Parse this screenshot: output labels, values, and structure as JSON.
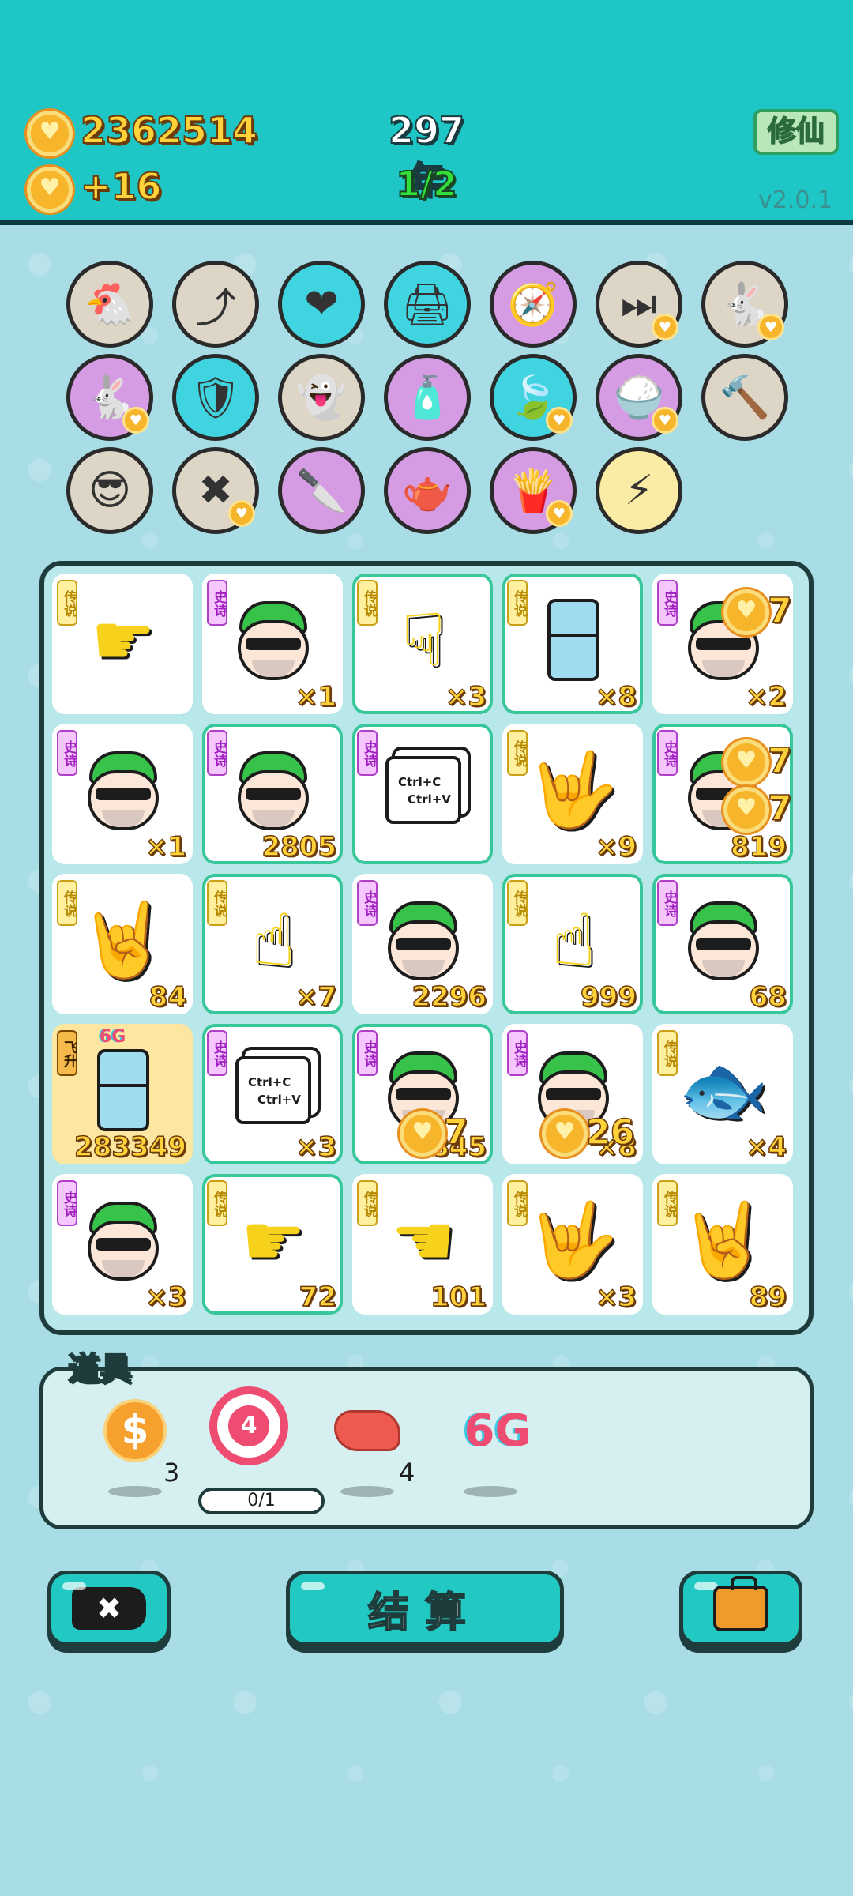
{
  "header": {
    "coins": "2362514",
    "income": "+16",
    "year": "297年",
    "round": "1/2",
    "cultivate_button": "修仙",
    "version": "v2.0.1"
  },
  "relics": [
    {
      "name": "hen-egg",
      "glyph": "🐔",
      "color": "beige"
    },
    {
      "name": "upgrade-arrow",
      "glyph": "⤴",
      "color": "beige"
    },
    {
      "name": "heart-bowl",
      "glyph": "❤",
      "color": "cyan"
    },
    {
      "name": "printer-warning",
      "glyph": "🖨",
      "color": "cyan"
    },
    {
      "name": "compass",
      "glyph": "🧭",
      "color": "purple"
    },
    {
      "name": "skip-tag",
      "glyph": "⏭",
      "color": "beige",
      "badge": true
    },
    {
      "name": "rabbit-white",
      "glyph": "🐇",
      "color": "beige",
      "badge": true
    },
    {
      "name": "rabbit-pink",
      "glyph": "🐇",
      "color": "purple",
      "badge": true
    },
    {
      "name": "shield-wrench",
      "glyph": "🛡",
      "color": "cyan"
    },
    {
      "name": "ghost",
      "glyph": "👻",
      "color": "beige"
    },
    {
      "name": "spray-bottle",
      "glyph": "🧴",
      "color": "purple"
    },
    {
      "name": "leaf",
      "glyph": "🍃",
      "color": "cyan",
      "badge": true
    },
    {
      "name": "rice-bowl",
      "glyph": "🍚",
      "color": "purple",
      "badge": true
    },
    {
      "name": "hammer",
      "glyph": "🔨",
      "color": "beige"
    },
    {
      "name": "sunglasses-cat",
      "glyph": "😎",
      "color": "beige"
    },
    {
      "name": "delete-tag",
      "glyph": "✖",
      "color": "beige",
      "badge": true
    },
    {
      "name": "cleaver",
      "glyph": "🔪",
      "color": "purple"
    },
    {
      "name": "gravy-boat",
      "glyph": "🫖",
      "color": "purple"
    },
    {
      "name": "fries",
      "glyph": "🍟",
      "color": "purple",
      "badge": true
    },
    {
      "name": "lightning",
      "glyph": "⚡",
      "color": "yellow"
    }
  ],
  "board": [
    {
      "tag": "传说",
      "tier": "legend",
      "kind": "pointer",
      "glyph": "☛",
      "count": "",
      "glow": false
    },
    {
      "tag": "史诗",
      "tier": "epic",
      "kind": "face",
      "count": "×1",
      "glow": false
    },
    {
      "tag": "传说",
      "tier": "legend",
      "kind": "pointer",
      "glyph": "☟",
      "count": "×3",
      "glow": true
    },
    {
      "tag": "传说",
      "tier": "legend",
      "kind": "fridge",
      "count": "×8",
      "glow": true
    },
    {
      "tag": "史诗",
      "tier": "epic",
      "kind": "face",
      "count": "×2",
      "glow": false
    },
    {
      "tag": "史诗",
      "tier": "epic",
      "kind": "face",
      "count": "×1",
      "glow": false
    },
    {
      "tag": "史诗",
      "tier": "epic",
      "kind": "face",
      "count": "2805",
      "glow": true
    },
    {
      "tag": "史诗",
      "tier": "epic",
      "kind": "copy",
      "count": "",
      "glow": true
    },
    {
      "tag": "传说",
      "tier": "legend",
      "kind": "pointer",
      "glyph": "🤟",
      "count": "×9",
      "glow": false
    },
    {
      "tag": "史诗",
      "tier": "epic",
      "kind": "face",
      "count": "819",
      "glow": true
    },
    {
      "tag": "传说",
      "tier": "legend",
      "kind": "pointer",
      "glyph": "🤘",
      "count": "84",
      "glow": false
    },
    {
      "tag": "传说",
      "tier": "legend",
      "kind": "pointer",
      "glyph": "☝",
      "count": "×7",
      "glow": true
    },
    {
      "tag": "史诗",
      "tier": "epic",
      "kind": "face",
      "count": "2296",
      "glow": false
    },
    {
      "tag": "传说",
      "tier": "legend",
      "kind": "pointer",
      "glyph": "☝",
      "count": "999",
      "glow": true
    },
    {
      "tag": "史诗",
      "tier": "epic",
      "kind": "face",
      "count": "68",
      "glow": true
    },
    {
      "tag": "飞升",
      "tier": "ascend",
      "kind": "fridge",
      "count": "283349",
      "glow": false,
      "gold": true,
      "label": "6G"
    },
    {
      "tag": "史诗",
      "tier": "epic",
      "kind": "copy",
      "count": "×3",
      "glow": true
    },
    {
      "tag": "史诗",
      "tier": "epic",
      "kind": "face",
      "count": "845",
      "glow": true
    },
    {
      "tag": "史诗",
      "tier": "epic",
      "kind": "face",
      "count": "×8",
      "glow": false
    },
    {
      "tag": "传说",
      "tier": "legend",
      "kind": "pointer",
      "glyph": "🐟",
      "count": "×4",
      "glow": false
    },
    {
      "tag": "史诗",
      "tier": "epic",
      "kind": "face",
      "count": "×3",
      "glow": false
    },
    {
      "tag": "传说",
      "tier": "legend",
      "kind": "pointer",
      "glyph": "☛",
      "count": "72",
      "glow": true
    },
    {
      "tag": "传说",
      "tier": "legend",
      "kind": "pointer",
      "glyph": "☚",
      "count": "101",
      "glow": false
    },
    {
      "tag": "传说",
      "tier": "legend",
      "kind": "pointer",
      "glyph": "🤟",
      "count": "×3",
      "glow": false
    },
    {
      "tag": "传说",
      "tier": "legend",
      "kind": "pointer",
      "glyph": "🤘",
      "count": "89",
      "glow": false
    }
  ],
  "copy_text": {
    "line1": "Ctrl+C",
    "line2": "Ctrl+V"
  },
  "floating_numbers": [
    "7",
    "7",
    "7",
    "7",
    "26"
  ],
  "items": {
    "label": "道具",
    "coin_count": "3",
    "target_value": "4",
    "target_progress": "0/1",
    "liver_count": "4",
    "sixg_text": "6G"
  },
  "buttons": {
    "settle_label": "结算"
  },
  "colors": {
    "header_bg": "#1ec6c6",
    "body_bg": "#a9dde6",
    "accent_gold": "#ffd23a",
    "button_teal": "#22c9c2"
  }
}
